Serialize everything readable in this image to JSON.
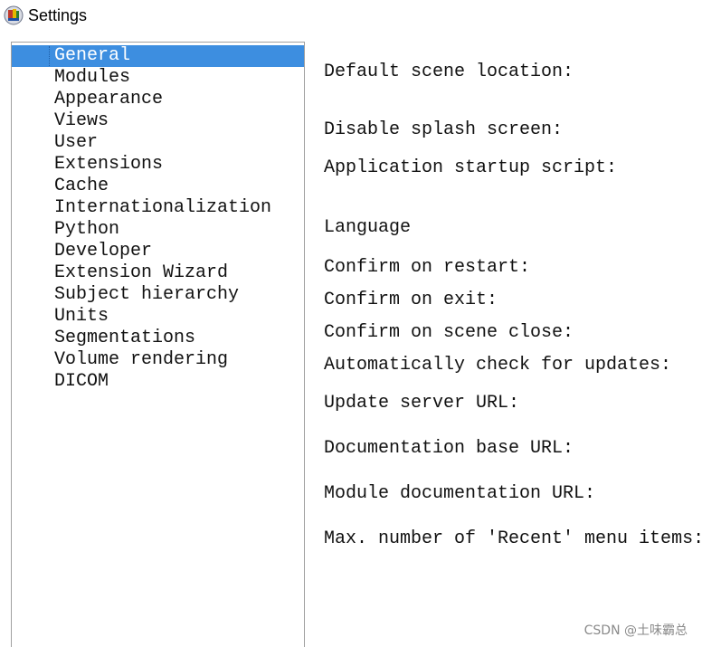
{
  "window": {
    "title": "Settings",
    "icon": "slicer-app-icon"
  },
  "sidebar": {
    "selected": "General",
    "items": [
      {
        "label": "General"
      },
      {
        "label": "Modules"
      },
      {
        "label": "Appearance"
      },
      {
        "label": "Views"
      },
      {
        "label": "User"
      },
      {
        "label": "Extensions"
      },
      {
        "label": "Cache"
      },
      {
        "label": "Internationalization"
      },
      {
        "label": "Python"
      },
      {
        "label": "Developer"
      },
      {
        "label": "Extension Wizard"
      },
      {
        "label": "Subject hierarchy"
      },
      {
        "label": "Units"
      },
      {
        "label": "Segmentations"
      },
      {
        "label": "Volume rendering"
      },
      {
        "label": "DICOM"
      }
    ]
  },
  "general_panel": {
    "default_scene_location": "Default scene location:",
    "disable_splash_screen": "Disable splash screen:",
    "application_startup_script": "Application startup script:",
    "language": "Language",
    "confirm_on_restart": "Confirm on restart:",
    "confirm_on_exit": "Confirm on exit:",
    "confirm_on_scene_close": "Confirm on scene close:",
    "automatically_check_for_updates": "Automatically check for updates:",
    "update_server_url": "Update server URL:",
    "documentation_base_url": "Documentation base URL:",
    "module_documentation_url": "Module documentation URL:",
    "max_recent_menu_items": "Max. number of 'Recent' menu items:"
  },
  "watermark": "CSDN @土味霸总",
  "colors": {
    "selection": "#3d8ee0",
    "border": "#a0a0a0"
  }
}
